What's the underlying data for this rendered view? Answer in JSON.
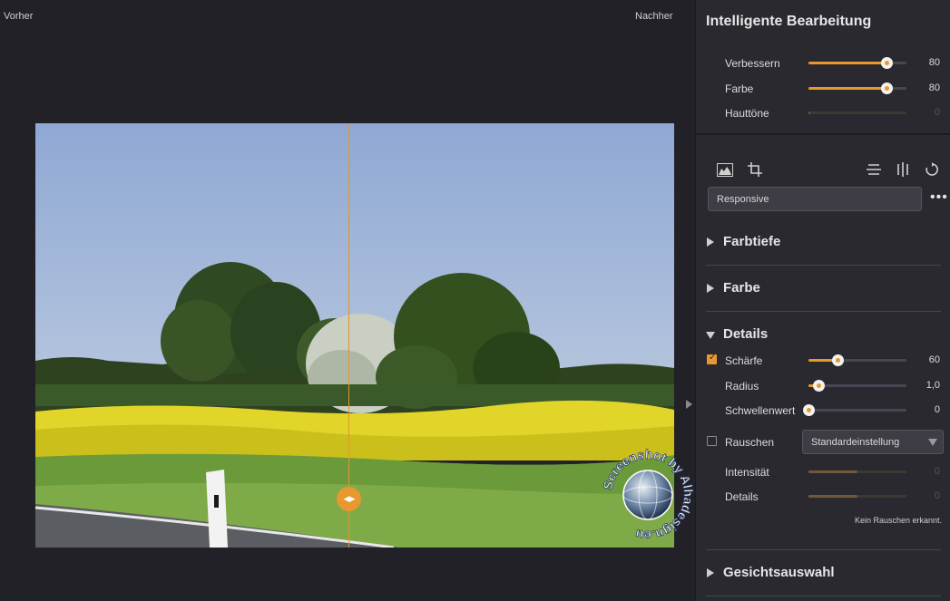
{
  "canvas": {
    "before_label": "Vorher",
    "after_label": "Nachher",
    "watermark_text": "Screenshot by Alhadesign.eu"
  },
  "panel": {
    "title": "Intelligente Bearbeitung",
    "smart_sliders": [
      {
        "label": "Verbessern",
        "value": 80,
        "enabled": true
      },
      {
        "label": "Farbe",
        "value": 80,
        "enabled": true
      },
      {
        "label": "Hauttöne",
        "value": 0,
        "enabled": false
      }
    ],
    "tools": [
      {
        "icon": "histogram-icon"
      },
      {
        "icon": "crop-icon"
      },
      {
        "icon": "flip-vertical-icon"
      },
      {
        "icon": "flip-horizontal-icon"
      },
      {
        "icon": "rotate-icon"
      }
    ],
    "preset": {
      "value": "Responsive",
      "more_icon": "more-dots-icon"
    },
    "sections": [
      {
        "title": "Farbtiefe",
        "expanded": false
      },
      {
        "title": "Farbe",
        "expanded": false
      },
      {
        "title": "Details",
        "expanded": true
      },
      {
        "title": "Gesichtsauswahl",
        "expanded": false
      }
    ],
    "details": {
      "sharpness": {
        "label": "Schärfe",
        "checked": true,
        "value": 60,
        "display": "60"
      },
      "radius": {
        "label": "Radius",
        "value": 1.0,
        "display": "1,0",
        "fraction": 0.1
      },
      "threshold": {
        "label": "Schwellenwert",
        "value": 0,
        "display": "0"
      },
      "noise": {
        "label": "Rauschen",
        "checked": false,
        "select_value": "Standardeinstellung"
      },
      "intensity": {
        "label": "Intensität",
        "value": 0,
        "display": "0",
        "fraction": 0.5
      },
      "noise_details": {
        "label": "Details",
        "value": 0,
        "display": "0",
        "fraction": 0.5
      },
      "status": "Kein Rauschen erkannt."
    }
  },
  "colors": {
    "accent": "#e8982f",
    "panel_bg": "#2a2930",
    "canvas_bg": "#232128"
  }
}
